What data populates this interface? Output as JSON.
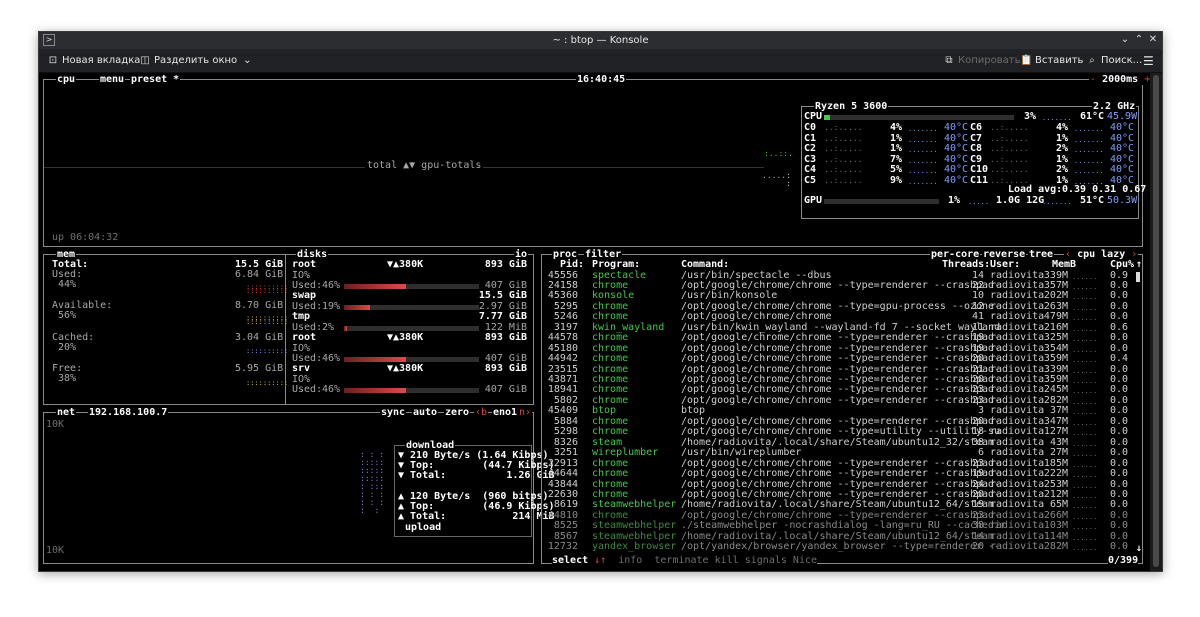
{
  "window": {
    "title": "~ : btop — Konsole",
    "colors": {
      "bg": "#000000",
      "accent_red": "#e04040",
      "accent_blue": "#7f9fff",
      "program_green": "#46c84a"
    }
  },
  "toolbar": {
    "new_tab": "Новая вкладка",
    "split": "Разделить окно",
    "copy": "Копировать",
    "paste": "Вставить",
    "search": "Поиск..."
  },
  "cpu": {
    "tabs": {
      "cpu": "cpu",
      "menu": "menu",
      "preset": "preset *"
    },
    "clock": "16:40:45",
    "interval": "2000ms",
    "center_label": "total ▲▼ gpu-totals",
    "uptime": "up 06:04:32",
    "model": "Ryzen 5 3600",
    "freq": "2.2 GHz",
    "total_label": "CPU",
    "total_pct": "3%",
    "total_pct_value": 3,
    "total_temp": "61°C",
    "total_power": "45.9W",
    "cores": [
      {
        "name": "C0",
        "pct": "4%",
        "temp": "40°C"
      },
      {
        "name": "C1",
        "pct": "1%",
        "temp": "40°C"
      },
      {
        "name": "C2",
        "pct": "1%",
        "temp": "40°C"
      },
      {
        "name": "C3",
        "pct": "7%",
        "temp": "40°C"
      },
      {
        "name": "C4",
        "pct": "5%",
        "temp": "40°C"
      },
      {
        "name": "C5",
        "pct": "9%",
        "temp": "40°C"
      },
      {
        "name": "C6",
        "pct": "4%",
        "temp": "40°C"
      },
      {
        "name": "C7",
        "pct": "1%",
        "temp": "40°C"
      },
      {
        "name": "C8",
        "pct": "2%",
        "temp": "40°C"
      },
      {
        "name": "C9",
        "pct": "1%",
        "temp": "40°C"
      },
      {
        "name": "C10",
        "pct": "2%",
        "temp": "40°C"
      },
      {
        "name": "C11",
        "pct": "1%",
        "temp": "40°C"
      }
    ],
    "load_label": "Load avg:",
    "load": "0.39 0.31 0.67",
    "gpu_label": "GPU",
    "gpu_pct": "1%",
    "gpu_mem": "1.0G 12G",
    "gpu_temp": "51°C",
    "gpu_power": "50.3W"
  },
  "mem": {
    "title": "mem",
    "total_label": "Total:",
    "total": "15.5 GiB",
    "used_label": "Used:",
    "used": "6.84 GiB",
    "used_pct": "44%",
    "avail_label": "Available:",
    "avail": "8.70 GiB",
    "avail_pct": "56%",
    "cached_label": "Cached:",
    "cached": "3.04 GiB",
    "cached_pct": "20%",
    "free_label": "Free:",
    "free": "5.95 GiB",
    "free_pct": "38%"
  },
  "disks": {
    "title": "disks",
    "io_tab": "io",
    "items": [
      {
        "name": "root",
        "io_rate": "▼▲380K",
        "size": "893 GiB",
        "io": "IO%",
        "used_label": "Used:",
        "used_pct": "46%",
        "used": "407 GiB",
        "fill": 0.46
      },
      {
        "name": "swap",
        "io_rate": "",
        "size": "15.5 GiB",
        "io": "",
        "used_label": "Used:",
        "used_pct": "19%",
        "used": "2.97 GiB",
        "fill": 0.19
      },
      {
        "name": "tmp",
        "io_rate": "",
        "size": "7.77 GiB",
        "io": "",
        "used_label": "Used:",
        "used_pct": "2%",
        "used": "122 MiB",
        "fill": 0.02
      },
      {
        "name": "root",
        "io_rate": "▼▲380K",
        "size": "893 GiB",
        "io": "IO%",
        "used_label": "Used:",
        "used_pct": "46%",
        "used": "407 GiB",
        "fill": 0.46
      },
      {
        "name": "srv",
        "io_rate": "▼▲380K",
        "size": "893 GiB",
        "io": "IO%",
        "used_label": "Used:",
        "used_pct": "46%",
        "used": "407 GiB",
        "fill": 0.46
      }
    ]
  },
  "net": {
    "title": "net",
    "ip": "192.168.100.7",
    "sync": "sync",
    "auto": "auto",
    "zero": "zero",
    "prev": "‹b",
    "iface": "eno1",
    "next": "n›",
    "scale_top": "10K",
    "scale_bottom": "10K",
    "download_label": "download",
    "dl_rate": "▼ 210 Byte/s (1.64 Kibps)",
    "dl_top": "▼ Top:        (44.7 Kibps)",
    "dl_total": "▼ Total:          1.26 GiB",
    "ul_rate": "▲ 120 Byte/s  (960 bitps)",
    "ul_top": "▲ Top:        (46.9 Kibps)",
    "ul_total": "▲ Total:           214 MiB",
    "upload_label": "upload"
  },
  "proc": {
    "title": "proc",
    "filter": "filter",
    "per_core": "per-core",
    "reverse": "reverse",
    "tree": "tree",
    "sort": "cpu lazy",
    "headers": {
      "pid": "Pid:",
      "program": "Program:",
      "command": "Command:",
      "threads": "Threads:",
      "user": "User:",
      "mem": "MemB",
      "cpu": "Cpu%"
    },
    "rows": [
      {
        "pid": "45556",
        "program": "spectacle",
        "command": "/usr/bin/spectacle --dbus",
        "threads": "14",
        "user": "radiovita",
        "mem": "339M",
        "cpu": "0.9"
      },
      {
        "pid": "24158",
        "program": "chrome",
        "command": "/opt/google/chrome/chrome --type=renderer --crashpad-",
        "threads": "22",
        "user": "radiovita",
        "mem": "357M",
        "cpu": "0.0"
      },
      {
        "pid": "45360",
        "program": "konsole",
        "command": "/usr/bin/konsole",
        "threads": "10",
        "user": "radiovita",
        "mem": "202M",
        "cpu": "0.0"
      },
      {
        "pid": "5295",
        "program": "chrome",
        "command": "/opt/google/chrome/chrome --type=gpu-process --ozone-",
        "threads": "12",
        "user": "radiovita",
        "mem": "263M",
        "cpu": "0.0"
      },
      {
        "pid": "5246",
        "program": "chrome",
        "command": "/opt/google/chrome/chrome",
        "threads": "41",
        "user": "radiovita",
        "mem": "479M",
        "cpu": "0.0"
      },
      {
        "pid": "3197",
        "program": "kwin_wayland",
        "command": "/usr/bin/kwin_wayland --wayland-fd 7 --socket wayland",
        "threads": "11",
        "user": "radiovita",
        "mem": "216M",
        "cpu": "0.6"
      },
      {
        "pid": "44578",
        "program": "chrome",
        "command": "/opt/google/chrome/chrome --type=renderer --crashpad-",
        "threads": "19",
        "user": "radiovita",
        "mem": "325M",
        "cpu": "0.0"
      },
      {
        "pid": "45180",
        "program": "chrome",
        "command": "/opt/google/chrome/chrome --type=renderer --crashpad-",
        "threads": "19",
        "user": "radiovita",
        "mem": "354M",
        "cpu": "0.0"
      },
      {
        "pid": "44942",
        "program": "chrome",
        "command": "/opt/google/chrome/chrome --type=renderer --crashpad-",
        "threads": "20",
        "user": "radiovita",
        "mem": "359M",
        "cpu": "0.4"
      },
      {
        "pid": "23515",
        "program": "chrome",
        "command": "/opt/google/chrome/chrome --type=renderer --crashpad-",
        "threads": "21",
        "user": "radiovita",
        "mem": "339M",
        "cpu": "0.0"
      },
      {
        "pid": "43871",
        "program": "chrome",
        "command": "/opt/google/chrome/chrome --type=renderer --crashpad-",
        "threads": "20",
        "user": "radiovita",
        "mem": "359M",
        "cpu": "0.0"
      },
      {
        "pid": "18941",
        "program": "chrome",
        "command": "/opt/google/chrome/chrome --type=renderer --crashpad-",
        "threads": "23",
        "user": "radiovita",
        "mem": "245M",
        "cpu": "0.0"
      },
      {
        "pid": "5802",
        "program": "chrome",
        "command": "/opt/google/chrome/chrome --type=renderer --crashpad-",
        "threads": "23",
        "user": "radiovita",
        "mem": "282M",
        "cpu": "0.0"
      },
      {
        "pid": "45409",
        "program": "btop",
        "command": "btop",
        "threads": "3",
        "user": "radiovita",
        "mem": "37M",
        "cpu": "0.0"
      },
      {
        "pid": "5884",
        "program": "chrome",
        "command": "/opt/google/chrome/chrome --type=renderer --crashpad-",
        "threads": "20",
        "user": "radiovita",
        "mem": "347M",
        "cpu": "0.0"
      },
      {
        "pid": "5298",
        "program": "chrome",
        "command": "/opt/google/chrome/chrome --type=utility --utility-su",
        "threads": "18",
        "user": "radiovita",
        "mem": "127M",
        "cpu": "0.0"
      },
      {
        "pid": "8326",
        "program": "steam",
        "command": "/home/radiovita/.local/share/Steam/ubuntu12_32/steam",
        "threads": "38",
        "user": "radiovita",
        "mem": "43M",
        "cpu": "0.0"
      },
      {
        "pid": "3251",
        "program": "wireplumber",
        "command": "/usr/bin/wireplumber",
        "threads": "6",
        "user": "radiovita",
        "mem": "27M",
        "cpu": "0.0"
      },
      {
        "pid": "22913",
        "program": "chrome",
        "command": "/opt/google/chrome/chrome --type=renderer --crashpad-",
        "threads": "23",
        "user": "radiovita",
        "mem": "185M",
        "cpu": "0.0"
      },
      {
        "pid": "44644",
        "program": "chrome",
        "command": "/opt/google/chrome/chrome --type=renderer --crashpad-",
        "threads": "19",
        "user": "radiovita",
        "mem": "222M",
        "cpu": "0.0"
      },
      {
        "pid": "43844",
        "program": "chrome",
        "command": "/opt/google/chrome/chrome --type=renderer --crashpad-",
        "threads": "24",
        "user": "radiovita",
        "mem": "253M",
        "cpu": "0.0"
      },
      {
        "pid": "22630",
        "program": "chrome",
        "command": "/opt/google/chrome/chrome --type=renderer --crashpad-",
        "threads": "20",
        "user": "radiovita",
        "mem": "212M",
        "cpu": "0.0"
      },
      {
        "pid": "8619",
        "program": "steamwebhelper",
        "command": "/home/radiovita/.local/share/Steam/ubuntu12_64/steam",
        "threads": "19",
        "user": "radiovita",
        "mem": "65M",
        "cpu": "0.0"
      },
      {
        "pid": "44810",
        "program": "chrome",
        "command": "/opt/google/chrome/chrome --type=renderer --crashpad-",
        "threads": "23",
        "user": "radiovita",
        "mem": "266M",
        "cpu": "0.0"
      },
      {
        "pid": "8525",
        "program": "steamwebhelper",
        "command": "./steamwebhelper -nocrashdialog -lang=ru_RU --cachedir",
        "threads": "38",
        "user": "radiovita",
        "mem": "103M",
        "cpu": "0.0"
      },
      {
        "pid": "8567",
        "program": "steamwebhelper",
        "command": "/home/radiovita/.local/share/Steam/ubuntu12_64/steam",
        "threads": "14",
        "user": "radiovita",
        "mem": "114M",
        "cpu": "0.0"
      },
      {
        "pid": "12732",
        "program": "yandex_browser",
        "command": "/opt/yandex/browser/yandex_browser --type=renderer --",
        "threads": "20",
        "user": "radiovita",
        "mem": "282M",
        "cpu": "0.0"
      }
    ],
    "footer": {
      "select": "select",
      "info": "info",
      "terminate": "terminate",
      "kill": "kill",
      "signals": "signals",
      "nice": "Nice",
      "count": "0/399"
    }
  }
}
